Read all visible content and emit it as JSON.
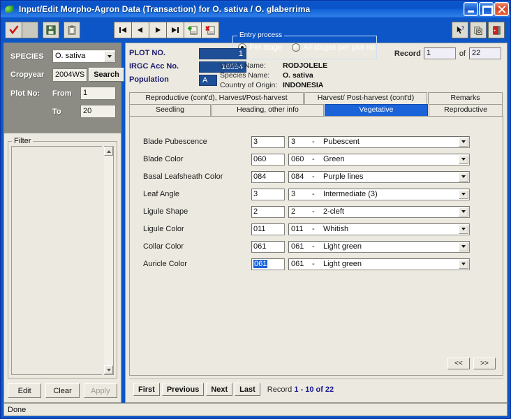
{
  "window": {
    "title": "Input/Edit Morpho-Agron Data (Transaction) for O. sativa / O. glaberrima",
    "icon": "leaf-icon",
    "minimize": "minimize-icon",
    "maximize": "maximize-icon",
    "close": "close-icon"
  },
  "toolbar": {
    "check_icon": "red-check-icon",
    "blank_icon": "blank-icon",
    "save_icon": "floppy-save-icon",
    "clipboard_icon": "clipboard-icon",
    "first_icon": "first-record-icon",
    "prev_icon": "previous-record-icon",
    "next_icon": "next-record-icon",
    "last_icon": "last-record-icon",
    "add_icon": "add-record-icon",
    "delete_icon": "delete-record-icon",
    "help_icon": "help-arrow-icon",
    "print_icon": "print-copy-icon",
    "exit_icon": "exit-door-icon"
  },
  "entry_process": {
    "legend": "Entry process",
    "options": [
      {
        "label": "Per stage",
        "checked": true
      },
      {
        "label": "All stages per plot no.",
        "checked": false
      }
    ]
  },
  "query": {
    "species_label": "SPECIES",
    "species_value": "O. sativa",
    "cropyear_label": "Cropyear",
    "cropyear_value": "2004WS",
    "search_label": "Search",
    "plotno_label": "Plot No:",
    "from_label": "From",
    "from_value": "1",
    "to_label": "To",
    "to_value": "20"
  },
  "filter": {
    "legend": "Filter",
    "items": [],
    "buttons": [
      {
        "label": "Edit",
        "disabled": false
      },
      {
        "label": "Clear",
        "disabled": false
      },
      {
        "label": "Apply",
        "disabled": true
      }
    ]
  },
  "header": {
    "plot_no_label": "PLOT NO.",
    "plot_no_value": "1",
    "irgc_label": "IRGC Acc No.",
    "irgc_value": "16554",
    "population_label": "Population",
    "population_value": "A",
    "variety_label": "Variety Name:",
    "variety_value": "RODJOLELE",
    "species_label": "Species Name:",
    "species_value": "O. sativa",
    "origin_label": "Country of Origin:",
    "origin_value": "INDONESIA",
    "record_label": "Record",
    "record_value": "1",
    "record_of": "of",
    "record_total": "22"
  },
  "tabs": {
    "row1": [
      {
        "label": "Reproductive (cont'd), Harvest/Post-harvest",
        "active": false
      },
      {
        "label": "Harvest/ Post-harvest (cont'd)",
        "active": false
      },
      {
        "label": "Remarks",
        "active": false
      }
    ],
    "row2": [
      {
        "label": "Seedling",
        "active": false
      },
      {
        "label": "Heading, other info",
        "active": false
      },
      {
        "label": "Vegetative",
        "active": true
      },
      {
        "label": "Reproductive",
        "active": false
      }
    ]
  },
  "form": {
    "rows": [
      {
        "label": "Blade Pubescence",
        "code": "3",
        "opt_code": "3",
        "dash": "-",
        "opt_text": "Pubescent",
        "selected": false
      },
      {
        "label": "Blade Color",
        "code": "060",
        "opt_code": "060",
        "dash": "-",
        "opt_text": "Green",
        "selected": false
      },
      {
        "label": "Basal Leafsheath Color",
        "code": "084",
        "opt_code": "084",
        "dash": "-",
        "opt_text": "Purple lines",
        "selected": false
      },
      {
        "label": "Leaf Angle",
        "code": "3",
        "opt_code": "3",
        "dash": "-",
        "opt_text": "Intermediate (3)",
        "selected": false
      },
      {
        "label": "Ligule Shape",
        "code": "2",
        "opt_code": "2",
        "dash": "-",
        "opt_text": "2-cleft",
        "selected": false
      },
      {
        "label": "Ligule Color",
        "code": "011",
        "opt_code": "011",
        "dash": "-",
        "opt_text": "Whitish",
        "selected": false
      },
      {
        "label": "Collar Color",
        "code": "061",
        "opt_code": "061",
        "dash": "-",
        "opt_text": "Light green",
        "selected": false
      },
      {
        "label": "Auricle Color",
        "code": "061",
        "opt_code": "061",
        "dash": "-",
        "opt_text": "Light green",
        "selected": true
      }
    ],
    "page_prev": "<<",
    "page_next": ">>"
  },
  "recnav": {
    "buttons": [
      "First",
      "Previous",
      "Next",
      "Last"
    ],
    "record_label": "Record",
    "record_range": "1 - 10 of 22"
  },
  "statusbar": {
    "text": "Done"
  },
  "colors": {
    "titlebar_blue": "#0c56c8",
    "accent_blue": "#1b63d8",
    "field_blue": "#1e4f96",
    "panel_gray": "#ece9e0",
    "sidebar_gray": "#8c8c84",
    "label_navy": "#1a1a6e"
  }
}
